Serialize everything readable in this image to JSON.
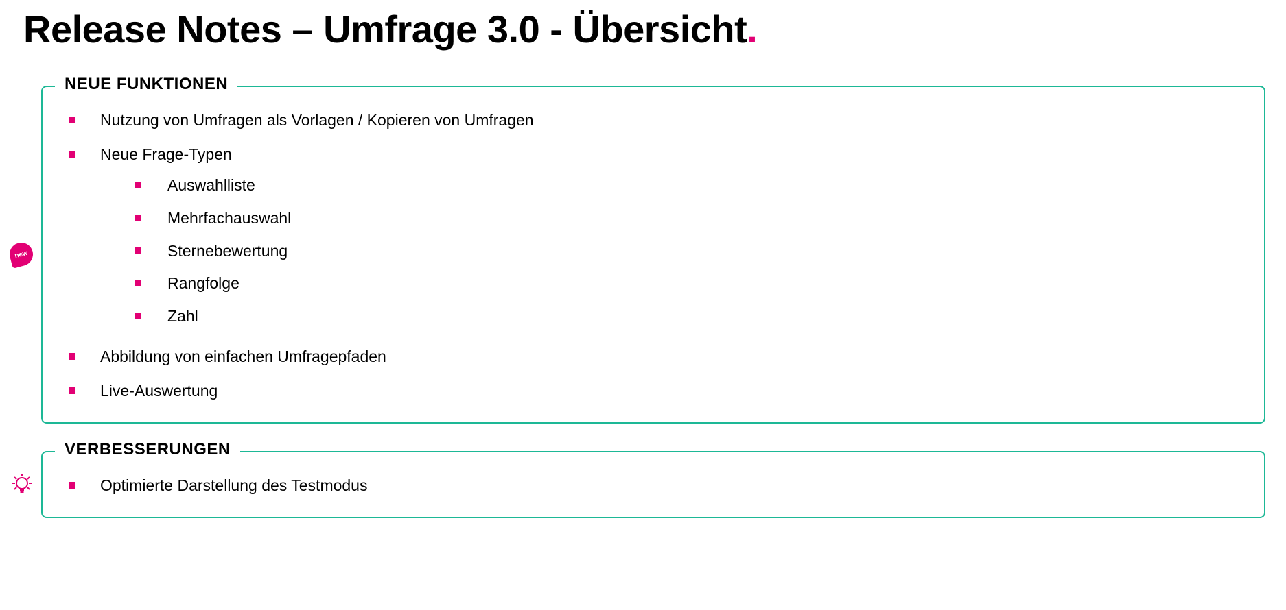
{
  "title_main": "Release Notes – Umfrage 3.0 - Übersicht",
  "title_dot": ".",
  "sections": {
    "new_features": {
      "legend": "NEUE FUNKTIONEN",
      "badge_label": "new",
      "items": {
        "0": "Nutzung von Umfragen als Vorlagen / Kopieren von Umfragen",
        "1": "Neue Frage-Typen",
        "1_sub": {
          "0": "Auswahlliste",
          "1": "Mehrfachauswahl",
          "2": "Sternebewertung",
          "3": "Rangfolge",
          "4": "Zahl"
        },
        "2": "Abbildung von einfachen Umfragepfaden",
        "3": "Live-Auswertung"
      }
    },
    "improvements": {
      "legend": "VERBESSERUNGEN",
      "items": {
        "0": "Optimierte Darstellung des Testmodus"
      }
    }
  },
  "colors": {
    "accent": "#e20074",
    "border": "#1db896"
  }
}
